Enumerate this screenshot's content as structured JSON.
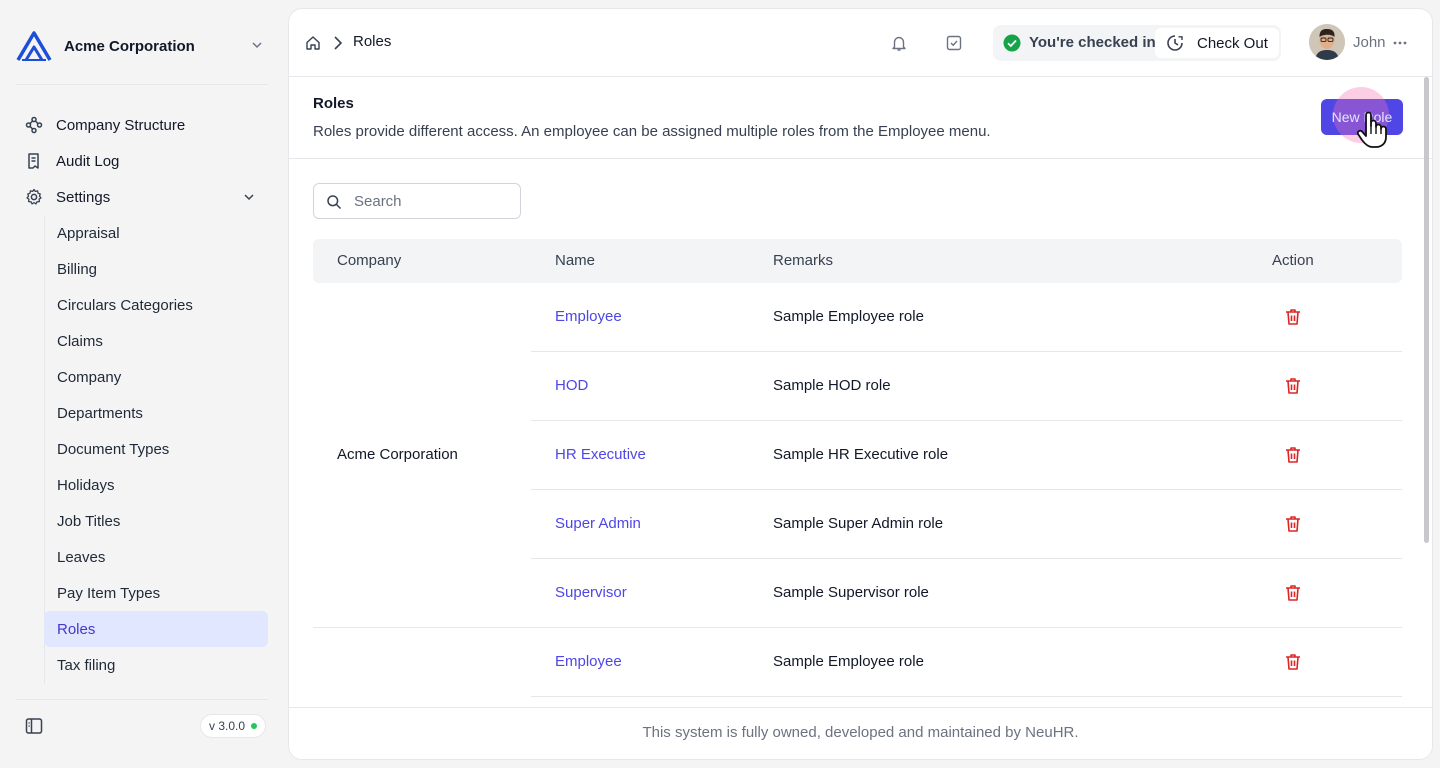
{
  "org": {
    "name": "Acme Corporation"
  },
  "sidebar": {
    "items": [
      {
        "label": "Company Structure",
        "icon": "hierarchy-icon"
      },
      {
        "label": "Audit Log",
        "icon": "audit-log-icon"
      },
      {
        "label": "Settings",
        "icon": "gear-icon"
      }
    ],
    "settings_items": [
      "Appraisal",
      "Billing",
      "Circulars Categories",
      "Claims",
      "Company",
      "Departments",
      "Document Types",
      "Holidays",
      "Job Titles",
      "Leaves",
      "Pay Item Types",
      "Roles",
      "Tax filing"
    ],
    "active_item": "Roles",
    "version": "v 3.0.0"
  },
  "header": {
    "breadcrumb": "Roles",
    "checkin_status": "You're checked in",
    "checkout_label": "Check Out",
    "user_name": "John"
  },
  "page": {
    "title": "Roles",
    "description": "Roles provide different access. An employee can be assigned multiple roles from the Employee menu.",
    "new_button": "New Role"
  },
  "search": {
    "placeholder": "Search",
    "value": ""
  },
  "table": {
    "columns": [
      "Company",
      "Name",
      "Remarks",
      "Action"
    ],
    "company": "Acme Corporation",
    "rows": [
      {
        "name": "Employee",
        "remarks": "Sample Employee role"
      },
      {
        "name": "HOD",
        "remarks": "Sample HOD role"
      },
      {
        "name": "HR Executive",
        "remarks": "Sample HR Executive role"
      },
      {
        "name": "Super Admin",
        "remarks": "Sample Super Admin role"
      },
      {
        "name": "Supervisor",
        "remarks": "Sample Supervisor role"
      },
      {
        "name": "Employee",
        "remarks": "Sample Employee role"
      }
    ]
  },
  "footer": {
    "text": "This system is fully owned, developed and maintained by NeuHR."
  },
  "colors": {
    "accent": "#4f46e5",
    "delete": "#dc2626",
    "active_bg": "#e0e7ff",
    "success": "#16a34a"
  }
}
